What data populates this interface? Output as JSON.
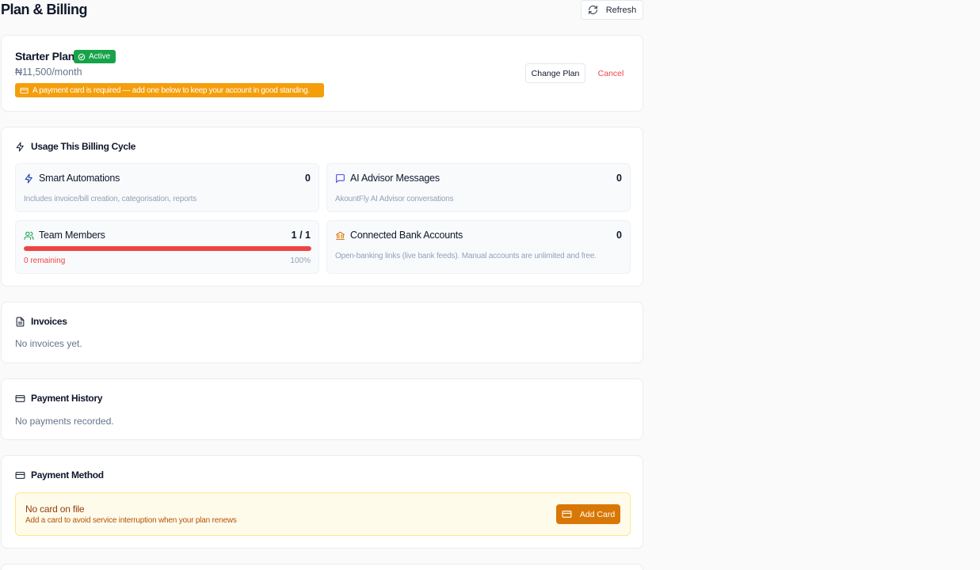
{
  "header": {
    "title": "Plan & Billing",
    "refresh_label": "Refresh"
  },
  "plan": {
    "name": "Starter Plan",
    "status": "Active",
    "price": "₦11,500/month",
    "warning": "A payment card is required — add one below to keep your account in good standing.",
    "change_label": "Change Plan",
    "cancel_label": "Cancel"
  },
  "usage": {
    "title": "Usage This Billing Cycle",
    "automations": {
      "label": "Smart Automations",
      "value": "0",
      "desc": "Includes invoice/bill creation, categorisation, reports"
    },
    "advisor": {
      "label": "AI Advisor Messages",
      "value": "0",
      "desc": "AkountFly AI Advisor conversations"
    },
    "team": {
      "label": "Team Members",
      "value": "1 / 1",
      "remaining": "0 remaining",
      "percent": "100%",
      "fill_fraction": 1.0
    },
    "bank": {
      "label": "Connected Bank Accounts",
      "value": "0",
      "desc": "Open-banking links (live bank feeds). Manual accounts are unlimited and free."
    }
  },
  "invoices": {
    "title": "Invoices",
    "empty": "No invoices yet."
  },
  "payments": {
    "title": "Payment History",
    "empty": "No payments recorded."
  },
  "payment_method": {
    "title": "Payment Method",
    "no_card_title": "No card on file",
    "no_card_desc": "Add a card to avoid service interruption when your plan renews",
    "add_label": "Add Card"
  },
  "colors": {
    "accent_green": "#16a34a",
    "warning_amber": "#f59e0b",
    "danger_red": "#ef4444",
    "add_button": "#d97706"
  },
  "icons": [
    "refresh-icon",
    "check-circle-icon",
    "credit-card-icon",
    "zap-icon",
    "message-icon",
    "users-icon",
    "bank-icon",
    "file-icon"
  ]
}
